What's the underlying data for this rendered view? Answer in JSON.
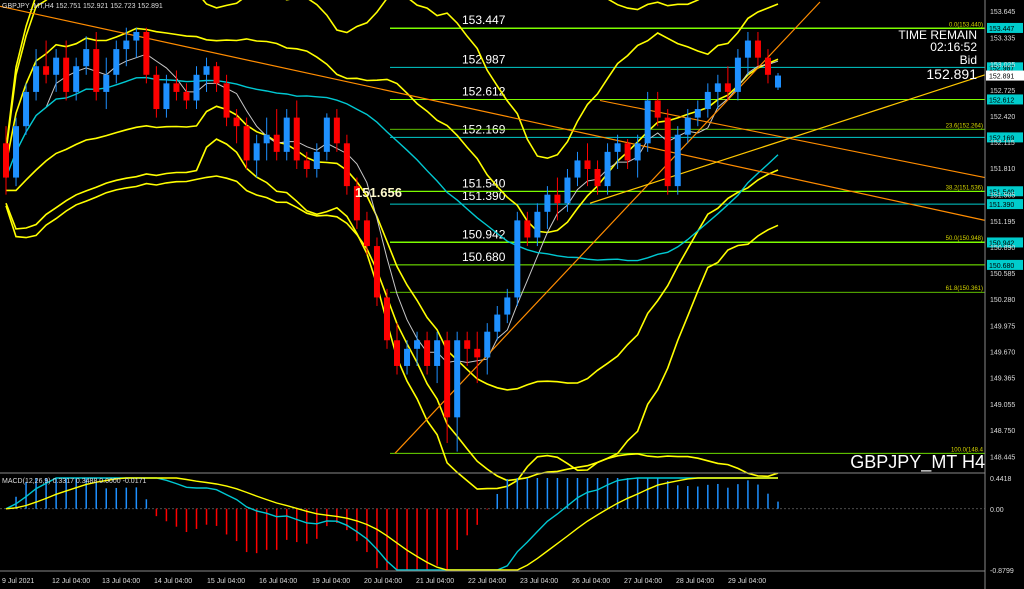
{
  "header": {
    "symbol": "GBPJPY_MT,H4",
    "ohlc": "152.751 152.921 152.723 152.891"
  },
  "info": {
    "time_remain_label": "TIME REMAIN",
    "time_remain": "02:16:52",
    "bid_label": "Bid",
    "bid": "152.891"
  },
  "watermark": "GBPJPY_MT H4",
  "macd_header": "MACD(12,26,9) 0.3317 0.3488 0.0000 -0.0171",
  "colors": {
    "background": "#000000",
    "bull": "#1e90ff",
    "bear": "#ff0000",
    "band": "#ffff00",
    "ma_cyan": "#00c8d2",
    "ma_white": "#c8c8c8",
    "hline": "#7cfc00",
    "hline_cyan": "#00cccc",
    "trend": "#ff8c00",
    "trend_gold": "#ffc800"
  },
  "chart_data": {
    "type": "candlestick",
    "symbol": "GBPJPY_MT",
    "timeframe": "H4",
    "ylim": [
      148.25,
      153.75
    ],
    "y_ticks": [
      "153.645",
      "153.335",
      "153.025",
      "152.725",
      "152.420",
      "152.115",
      "151.810",
      "151.505",
      "151.195",
      "150.890",
      "150.585",
      "150.280",
      "149.975",
      "149.670",
      "149.365",
      "149.055",
      "148.750",
      "148.445"
    ],
    "x_ticks": [
      "9 Jul 2021",
      "12 Jul 04:00",
      "13 Jul 04:00",
      "14 Jul 04:00",
      "15 Jul 04:00",
      "16 Jul 04:00",
      "19 Jul 04:00",
      "20 Jul 04:00",
      "21 Jul 04:00",
      "22 Jul 04:00",
      "23 Jul 04:00",
      "26 Jul 04:00",
      "27 Jul 04:00",
      "28 Jul 04:00",
      "29 Jul 04:00"
    ],
    "horizontal_lines": [
      {
        "value": 153.447,
        "label": "153.447",
        "tag": "153.447"
      },
      {
        "value": 152.987,
        "label": "152.987",
        "tag": "152.987"
      },
      {
        "value": 152.612,
        "label": "152.612",
        "tag": "152.612"
      },
      {
        "value": 152.169,
        "label": "152.169",
        "tag": "152.169"
      },
      {
        "value": 151.54,
        "label": "151.540",
        "tag": "151.540"
      },
      {
        "value": 151.39,
        "label": "151.390",
        "tag": "151.390"
      },
      {
        "value": 150.942,
        "label": "150.942",
        "tag": "150.942"
      },
      {
        "value": 150.68,
        "label": "150.680",
        "tag": "150.680"
      }
    ],
    "fibo_levels": [
      {
        "label": "0.0(153.440)",
        "value": 153.44
      },
      {
        "label": "23.6(152.264)",
        "value": 152.264
      },
      {
        "label": "38.2(151.536)",
        "value": 151.536
      },
      {
        "label": "50.0(150.948)",
        "value": 150.948
      },
      {
        "label": "61.8(150.361)",
        "value": 150.361
      },
      {
        "label": "100.0(148.4",
        "value": 148.48
      }
    ],
    "marker": {
      "label": "151.656",
      "value": 151.656
    },
    "current_price": 152.891,
    "candles": [
      [
        152.1,
        152.3,
        151.5,
        151.7
      ],
      [
        151.7,
        152.4,
        151.6,
        152.3
      ],
      [
        152.3,
        152.8,
        152.2,
        152.7
      ],
      [
        152.7,
        153.2,
        152.6,
        153.0
      ],
      [
        153.0,
        153.3,
        152.8,
        152.9
      ],
      [
        152.9,
        153.2,
        152.7,
        153.1
      ],
      [
        153.1,
        153.3,
        152.6,
        152.7
      ],
      [
        152.7,
        153.1,
        152.6,
        153.0
      ],
      [
        153.0,
        153.35,
        152.9,
        153.2
      ],
      [
        153.2,
        153.4,
        152.6,
        152.7
      ],
      [
        152.7,
        153.1,
        152.5,
        152.9
      ],
      [
        152.9,
        153.3,
        152.8,
        153.2
      ],
      [
        153.2,
        153.45,
        153.0,
        153.3
      ],
      [
        153.3,
        153.45,
        153.1,
        153.4
      ],
      [
        153.4,
        153.45,
        152.8,
        152.9
      ],
      [
        152.9,
        153.0,
        152.4,
        152.5
      ],
      [
        152.5,
        152.9,
        152.4,
        152.8
      ],
      [
        152.8,
        152.95,
        152.6,
        152.7
      ],
      [
        152.7,
        152.8,
        152.5,
        152.6
      ],
      [
        152.6,
        153.0,
        152.5,
        152.9
      ],
      [
        152.9,
        153.1,
        152.7,
        153.0
      ],
      [
        153.0,
        153.05,
        152.7,
        152.8
      ],
      [
        152.8,
        152.9,
        152.3,
        152.4
      ],
      [
        152.4,
        152.5,
        152.1,
        152.3
      ],
      [
        152.3,
        152.4,
        151.8,
        151.9
      ],
      [
        151.9,
        152.2,
        151.7,
        152.1
      ],
      [
        152.1,
        152.4,
        151.9,
        152.2
      ],
      [
        152.2,
        152.5,
        151.9,
        152.0
      ],
      [
        152.0,
        152.5,
        151.9,
        152.4
      ],
      [
        152.4,
        152.6,
        151.8,
        151.9
      ],
      [
        151.9,
        152.0,
        151.7,
        151.8
      ],
      [
        151.8,
        152.1,
        151.7,
        152.0
      ],
      [
        152.0,
        152.45,
        151.9,
        152.4
      ],
      [
        152.4,
        152.5,
        152.0,
        152.1
      ],
      [
        152.1,
        152.2,
        151.5,
        151.6
      ],
      [
        151.6,
        151.7,
        151.1,
        151.2
      ],
      [
        151.2,
        151.3,
        150.8,
        150.9
      ],
      [
        150.9,
        151.0,
        150.2,
        150.3
      ],
      [
        150.3,
        150.4,
        149.7,
        149.8
      ],
      [
        149.8,
        150.0,
        149.4,
        149.5
      ],
      [
        149.5,
        149.8,
        149.4,
        149.7
      ],
      [
        149.7,
        149.9,
        149.5,
        149.8
      ],
      [
        149.8,
        149.9,
        149.4,
        149.5
      ],
      [
        149.5,
        149.9,
        149.3,
        149.8
      ],
      [
        149.8,
        149.9,
        148.6,
        148.9
      ],
      [
        148.9,
        149.9,
        148.5,
        149.8
      ],
      [
        149.8,
        149.9,
        149.5,
        149.7
      ],
      [
        149.7,
        149.9,
        149.3,
        149.6
      ],
      [
        149.6,
        150.0,
        149.4,
        149.9
      ],
      [
        149.9,
        150.2,
        149.8,
        150.1
      ],
      [
        150.1,
        150.4,
        150.0,
        150.3
      ],
      [
        150.3,
        151.3,
        150.2,
        151.2
      ],
      [
        151.2,
        151.3,
        150.9,
        151.0
      ],
      [
        151.0,
        151.4,
        150.9,
        151.3
      ],
      [
        151.3,
        151.6,
        151.1,
        151.5
      ],
      [
        151.5,
        151.7,
        151.2,
        151.4
      ],
      [
        151.4,
        151.8,
        151.3,
        151.7
      ],
      [
        151.7,
        152.0,
        151.6,
        151.9
      ],
      [
        151.9,
        152.1,
        151.6,
        151.8
      ],
      [
        151.8,
        151.9,
        151.5,
        151.6
      ],
      [
        151.6,
        152.1,
        151.5,
        152.0
      ],
      [
        152.0,
        152.2,
        151.8,
        152.1
      ],
      [
        152.1,
        152.15,
        151.8,
        151.9
      ],
      [
        151.9,
        152.2,
        151.7,
        152.1
      ],
      [
        152.1,
        152.7,
        152.0,
        152.6
      ],
      [
        152.6,
        152.7,
        152.3,
        152.4
      ],
      [
        152.4,
        152.5,
        151.5,
        151.6
      ],
      [
        151.6,
        152.3,
        151.5,
        152.2
      ],
      [
        152.2,
        152.5,
        152.1,
        152.4
      ],
      [
        152.4,
        152.6,
        152.3,
        152.5
      ],
      [
        152.5,
        152.8,
        152.4,
        152.7
      ],
      [
        152.7,
        152.9,
        152.5,
        152.8
      ],
      [
        152.8,
        153.0,
        152.6,
        152.7
      ],
      [
        152.7,
        153.2,
        152.6,
        153.1
      ],
      [
        153.1,
        153.4,
        152.9,
        153.3
      ],
      [
        153.3,
        153.4,
        153.0,
        153.1
      ],
      [
        153.1,
        153.2,
        152.8,
        152.9
      ],
      [
        152.751,
        152.921,
        152.723,
        152.891
      ]
    ],
    "macd": {
      "ylim": [
        -0.8799,
        0.4418
      ],
      "ticks": [
        "0.4418",
        "0.00",
        "-0.8799"
      ],
      "current": {
        "macd": 0.3317,
        "signal": 0.3488,
        "hist": -0.0171
      }
    }
  }
}
